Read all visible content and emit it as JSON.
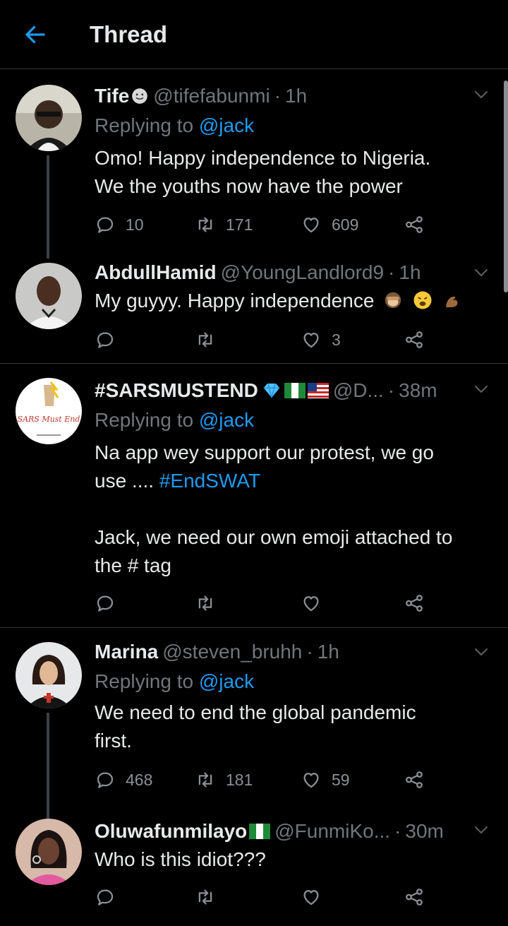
{
  "header": {
    "title": "Thread",
    "back_icon": "back-arrow-icon",
    "accent": "#1d9bf0"
  },
  "replying_label": "Replying to",
  "tweets": [
    {
      "name": "Tife",
      "handle": "@tifefabunmi",
      "sep": "·",
      "time": "1h",
      "reply_to": "@jack",
      "text_lines": [
        "Omo! Happy independence to Nigeria.",
        "We the youths now have the power"
      ],
      "replies": "10",
      "retweets": "171",
      "likes": "609"
    },
    {
      "name": "AbdullHamid",
      "handle": "@YoungLandlord9",
      "sep": "·",
      "time": "1h",
      "text": "My guyyy. Happy independence",
      "replies": "",
      "retweets": "",
      "likes": "3"
    },
    {
      "name": "#SARSMUSTEND",
      "handle": "@D...",
      "sep": "·",
      "time": "38m",
      "reply_to": "@jack",
      "text_line1": "Na app wey support our protest, we go",
      "text_line2_prefix": "use ....",
      "hashtag": "#EndSWAT",
      "text_line3": "Jack, we need our own emoji attached to",
      "text_line4": "the # tag",
      "avatar_text": "SARS Must End",
      "replies": "",
      "retweets": "",
      "likes": ""
    },
    {
      "name": "Marina",
      "handle": "@steven_bruhh",
      "sep": "·",
      "time": "1h",
      "reply_to": "@jack",
      "text_lines": [
        "We need to end the global pandemic",
        "first."
      ],
      "replies": "468",
      "retweets": "181",
      "likes": "59"
    },
    {
      "name": "Oluwafunmilayo",
      "handle": "@FunmiKo...",
      "sep": "·",
      "time": "30m",
      "text": "Who is this idiot???",
      "replies": "",
      "retweets": "",
      "likes": ""
    }
  ]
}
